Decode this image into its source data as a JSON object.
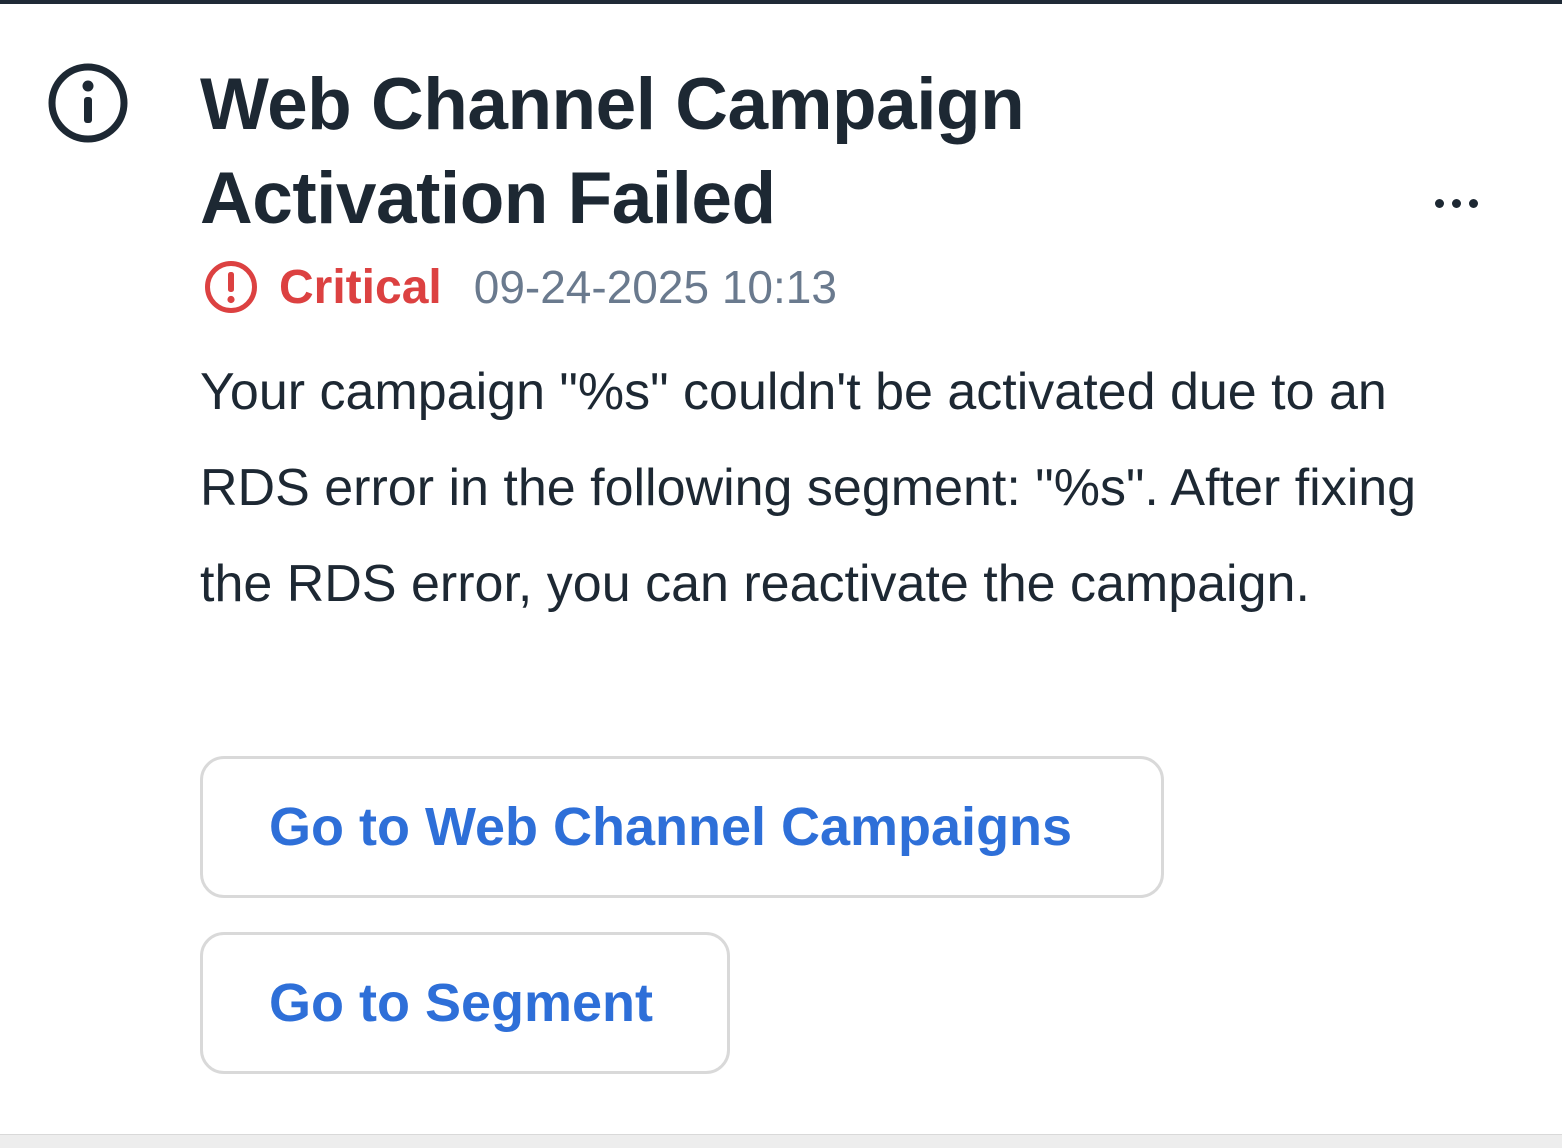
{
  "notification": {
    "title": "Web Channel Campaign Activation Failed",
    "severity": "Critical",
    "timestamp": "09-24-2025 10:13",
    "message": "Your campaign \"%s\" couldn't be activated due to an RDS error in the following segment: \"%s\". After fixing the RDS error, you can reactivate the campaign.",
    "actions": {
      "campaigns_label": "Go to Web Channel Campaigns",
      "segment_label": "Go to Segment"
    }
  },
  "icons": {
    "leading": "info-icon",
    "severity": "exclamation-circle-icon",
    "more": "ellipsis-icon"
  },
  "colors": {
    "title_text": "#1d2833",
    "critical": "#dc4141",
    "timestamp": "#6a7a8e",
    "link_blue": "#2e6fd8",
    "button_border": "#d9d9d9",
    "top_border": "#1f2a36"
  }
}
